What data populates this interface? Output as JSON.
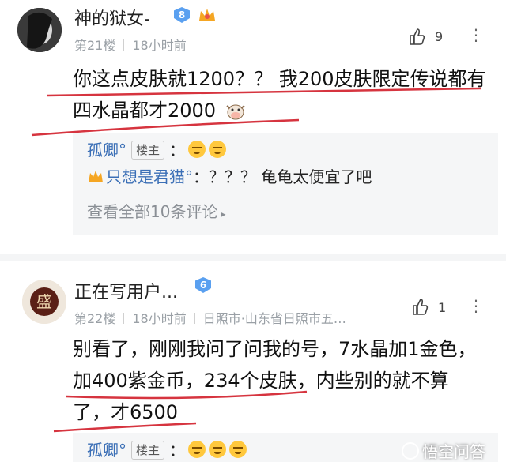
{
  "posts": [
    {
      "username": "神的狱女-",
      "level": "8",
      "floor": "第21楼",
      "time": "18小时前",
      "likes": "9",
      "content_lines": [
        "你这点皮肤就1200？？ 我200皮肤限定传说都有",
        "四水晶都才2000"
      ],
      "replies": [
        {
          "author": "孤卿°",
          "op_tag": "楼主",
          "text": "："
        },
        {
          "author": "只想是君猫°",
          "text": "：？？？ 龟龟太便宜了吧"
        }
      ],
      "view_all": "查看全部10条评论"
    },
    {
      "username": "正在写用户...",
      "level": "6",
      "floor": "第22楼",
      "time": "18小时前",
      "location": "日照市·山东省日照市五…",
      "likes": "1",
      "avatar_char": "盛",
      "content_lines": [
        "别看了，刚刚我问了问我的号，7水晶加1金色，",
        "加400紫金币，234个皮肤，内些别的就不算",
        "了，才6500"
      ],
      "replies": [
        {
          "author": "孤卿°",
          "op_tag": "楼主",
          "text": "："
        }
      ]
    }
  ],
  "watermark": "悟空问答",
  "colors": {
    "link": "#3b6fb6",
    "underline": "#d6343f",
    "badge": "#5aa0f0"
  }
}
